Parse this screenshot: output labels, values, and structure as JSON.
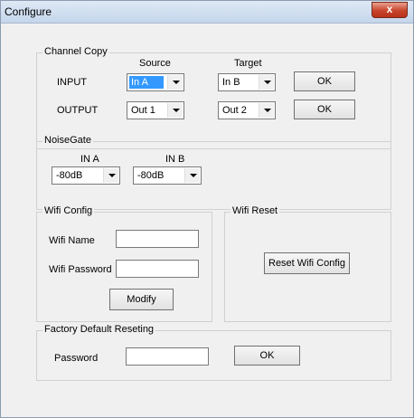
{
  "window": {
    "title": "Configure",
    "close_label": "x"
  },
  "channel_copy": {
    "title": "Channel Copy",
    "source_header": "Source",
    "target_header": "Target",
    "input_label": "INPUT",
    "output_label": "OUTPUT",
    "input_source": "In A",
    "input_target": "In B",
    "output_source": "Out 1",
    "output_target": "Out 2",
    "ok_label": "OK"
  },
  "noise_gate": {
    "title": "NoiseGate",
    "in_a_label": "IN A",
    "in_b_label": "IN B",
    "in_a_value": "-80dB",
    "in_b_value": "-80dB"
  },
  "wifi_config": {
    "title": "Wifi Config",
    "name_label": "Wifi Name",
    "name_value": "",
    "password_label": "Wifi Password",
    "password_value": "",
    "modify_label": "Modify"
  },
  "wifi_reset": {
    "title": "Wifi Reset",
    "button_label": "Reset Wifi Config"
  },
  "factory_reset": {
    "title": "Factory Default Reseting",
    "password_label": "Password",
    "password_value": "",
    "ok_label": "OK"
  }
}
